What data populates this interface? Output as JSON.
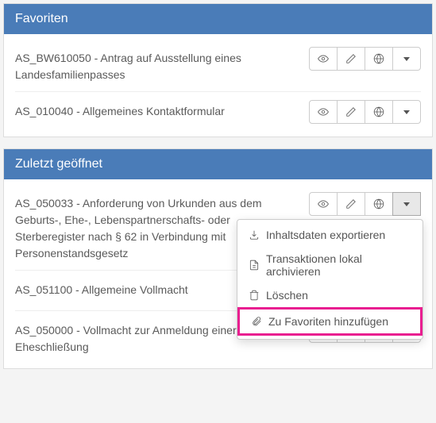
{
  "sections": {
    "favorites": {
      "title": "Favoriten"
    },
    "recent": {
      "title": "Zuletzt geöffnet"
    }
  },
  "favorites_items": [
    {
      "label": "AS_BW610050 - Antrag auf Ausstellung eines Landesfamilienpasses"
    },
    {
      "label": "AS_010040 - Allgemeines Kontaktformular"
    }
  ],
  "recent_items": [
    {
      "label": "AS_050033 - Anforderung von Urkunden aus dem Geburts-, Ehe-, Lebenspartnerschafts- oder Sterberegister nach § 62 in Verbindung mit Personenstandsgesetz"
    },
    {
      "label": "AS_051100 - Allgemeine Vollmacht"
    },
    {
      "label": "AS_050000 - Vollmacht zur Anmeldung einer Eheschließung"
    }
  ],
  "dropdown": {
    "export": "Inhaltsdaten exportieren",
    "archive": "Transaktionen lokal archivieren",
    "delete": "Löschen",
    "fav": "Zu Favoriten hinzufügen"
  }
}
